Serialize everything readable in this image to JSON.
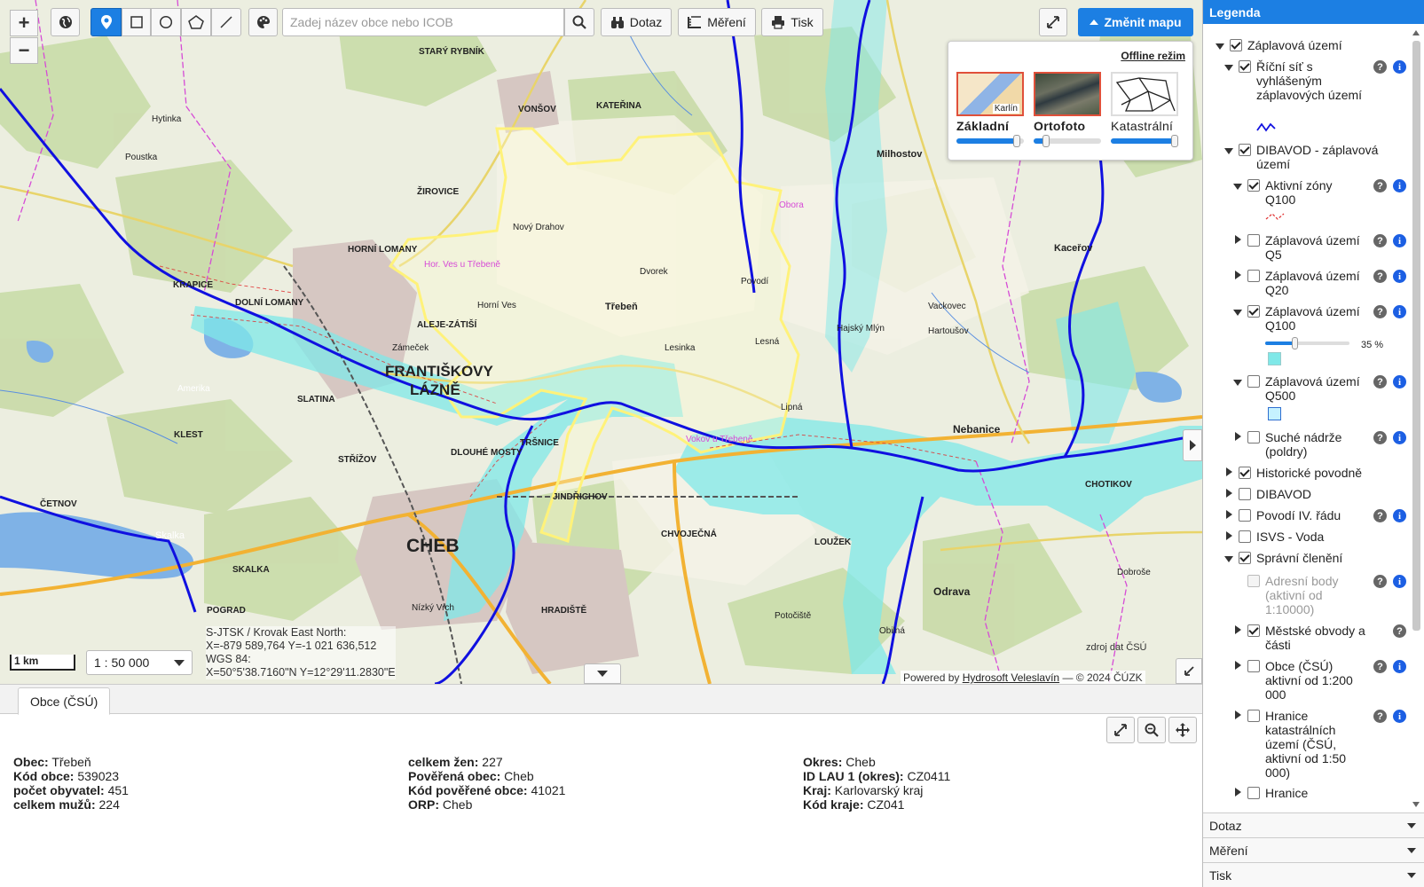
{
  "toolbar": {
    "search_placeholder": "Zadej název obce nebo ICOB",
    "query_label": "Dotaz",
    "measure_label": "Měření",
    "print_label": "Tisk",
    "change_map_label": "Změnit mapu"
  },
  "basemaps": {
    "offline_label": "Offline režim",
    "thumb_label": "Karlín",
    "items": [
      {
        "label": "Základní",
        "opacity": 0.95
      },
      {
        "label": "Ortofoto",
        "opacity": 0.2
      },
      {
        "label": "Katastrální",
        "opacity": 1.0
      }
    ]
  },
  "map": {
    "scale_bar": "1 km",
    "scale_value": "1 : 50 000",
    "coords_line1": "S-JTSK / Krovak East North:",
    "coords_line2": "X=-879 589,764 Y=-1 021 636,512",
    "coords_line3": "WGS 84:",
    "coords_line4": "X=50°5'38.7160\"N Y=12°29'11.2830\"E",
    "powered_prefix": "Powered by",
    "powered_link": "Hydrosoft Veleslavín",
    "powered_suffix": "— © 2024 ČÚZK",
    "source": "zdroj dat ČSÚ",
    "places": {
      "frantiskovy_1": "FRANTIŠKOVY",
      "frantiskovy_2": "LÁZNĚ",
      "cheb": "CHEB",
      "horni_lomany": "HORNÍ LOMANY",
      "trebeň": "Třebeň",
      "nebanice": "Nebanice",
      "odrava": "Odrava",
      "milhostov": "Milhostov",
      "kacerov": "Kaceřov",
      "slatina": "SLATINA",
      "lesinka": "Lesinka",
      "lesna": "Lesná",
      "povodi": "Povodí",
      "dvorek": "Dvorek",
      "horni_ves": "Horní Ves",
      "vonsov": "VONŠOV",
      "katerina": "KATEŘINA",
      "poustka": "Poustka",
      "hytinka": "Hytinka",
      "krapice": "KRAPICE",
      "zirovice": "ŽIROVICE",
      "klest": "KLEST",
      "strizov": "STŘÍŽOV",
      "skalka": "SKALKA",
      "jindrichov": "JINDŘICHOV",
      "chvojecna": "CHVOJEČNÁ",
      "louzek": "LOUŽEK",
      "hradiste": "HRADIŠTĚ",
      "chotikov": "CHOTIKOV",
      "cetnov": "ČETNOV",
      "trsnice": "TRŠNICE",
      "dlouhe_mosty": "DLOUHÉ MOSTY",
      "pograd": "POGRAD",
      "nizky_vrch": "Nízký Vrch",
      "skalka_lake": "Skalka",
      "amerika": "Amerika",
      "novy_drahov": "Nový Drahov",
      "hor_ves": "Hor. Ves u Třebeně",
      "vokov": "Vokov u Třebeně",
      "dobroše": "Dobroše",
      "potocinte": "Potočiště",
      "obilna": "Obilná",
      "hartousov": "Hartoušov",
      "vackovec": "Vackovec",
      "dolni_lomany": "DOLNÍ LOMANY",
      "aleje_zatisi": "ALEJE-ZÁTIŠÍ",
      "zamecek": "Zámeček",
      "stary_rybnik": "STARÝ RYBNÍK",
      "obora": "Obora",
      "lipna": "Lipná",
      "hajsky_mlyn": "Hajský Mlýn"
    }
  },
  "bottom": {
    "tab_label": "Obce (ČSÚ)",
    "col1": [
      {
        "k": "Obec",
        "v": "Třebeň"
      },
      {
        "k": "Kód obce",
        "v": "539023"
      },
      {
        "k": "počet obyvatel",
        "v": "451"
      },
      {
        "k": "celkem mužů",
        "v": "224"
      }
    ],
    "col2": [
      {
        "k": "celkem žen",
        "v": "227"
      },
      {
        "k": "Pověřená obec",
        "v": "Cheb"
      },
      {
        "k": "Kód pověřené obce",
        "v": "41021"
      },
      {
        "k": "ORP",
        "v": "Cheb"
      }
    ],
    "col3": [
      {
        "k": "Okres",
        "v": "Cheb"
      },
      {
        "k": "ID LAU 1 (okres)",
        "v": "CZ0411"
      },
      {
        "k": "Kraj",
        "v": "Karlovarský kraj"
      },
      {
        "k": "Kód kraje",
        "v": "CZ041"
      }
    ]
  },
  "legend": {
    "title": "Legenda",
    "items": {
      "zaplavova": "Záplavová území",
      "ricni_sit": "Říční síť s vyhlášeným záplavových území",
      "dibavod_zapl": "DIBAVOD - záplavová území",
      "aktivni_zony": "Aktivní zóny Q100",
      "q5": "Záplavová území Q5",
      "q20": "Záplavová území Q20",
      "q100": "Záplavová území Q100",
      "q100_opacity": "35 %",
      "q500": "Záplavová území Q500",
      "suche": "Suché nádrže (poldry)",
      "historicke": "Historické povodně",
      "dibavod": "DIBAVOD",
      "povodi": "Povodí IV. řádu",
      "isvs": "ISVS - Voda",
      "spravni": "Správní členění",
      "adresni": "Adresní body (aktivní od 1:10000)",
      "mestske": "Městské obvody a části",
      "obce": "Obce (ČSÚ) aktivní od 1:200 000",
      "hranice_kat": "Hranice katastrálních území (ČSÚ, aktivní od 1:50 000)",
      "hranice": "Hranice"
    },
    "q100_slider": 0.35,
    "accordion": {
      "query": "Dotaz",
      "measure": "Měření",
      "print": "Tisk"
    }
  },
  "colors": {
    "accent": "#1c7fe3",
    "flood": "#7fe8e8",
    "river": "#1010e0",
    "boundary": "#fff27a"
  }
}
